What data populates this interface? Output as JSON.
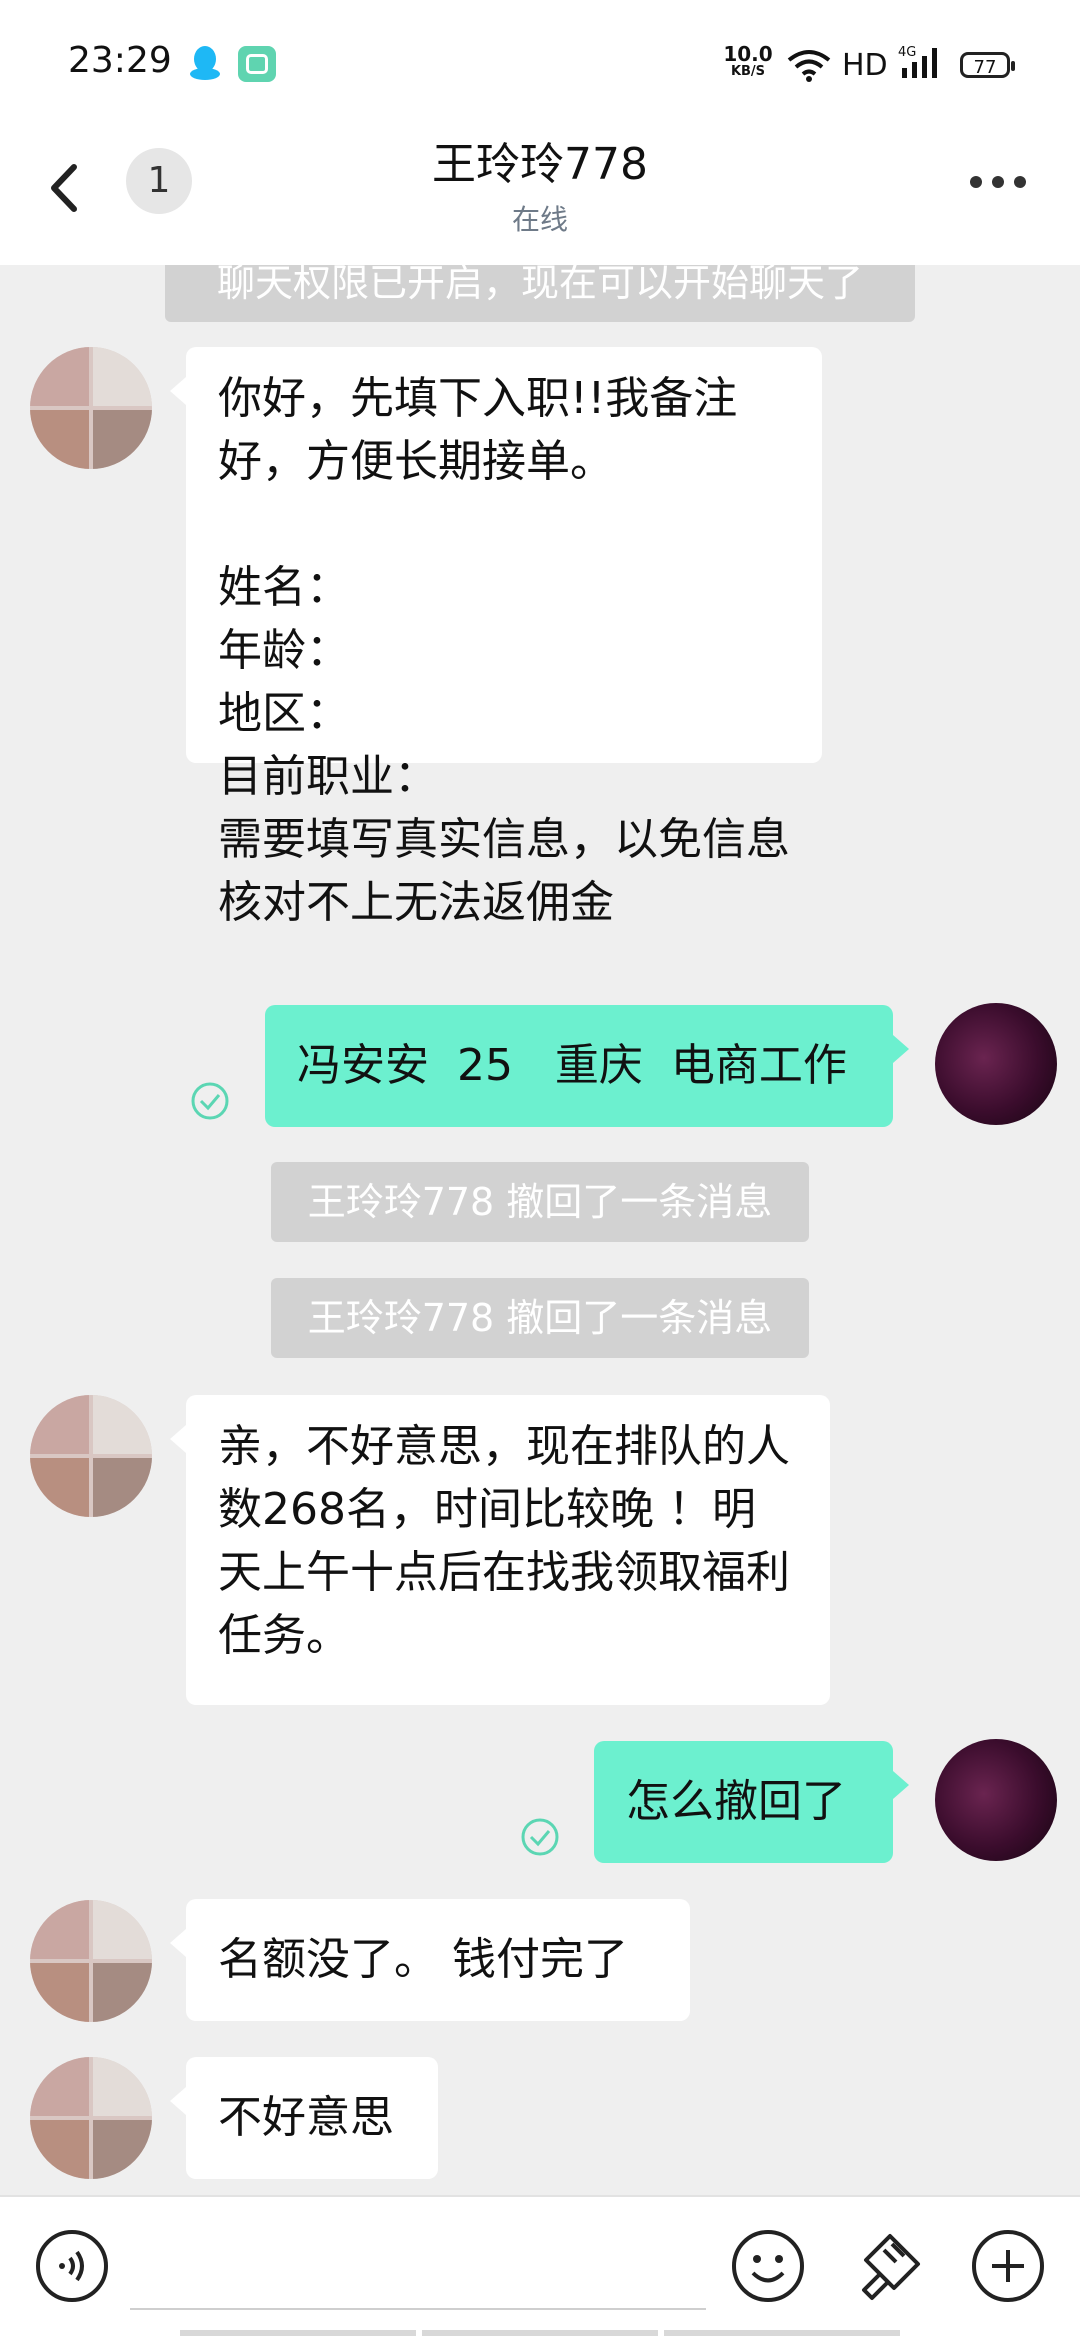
{
  "status_bar": {
    "time": "23:29",
    "net_speed_value": "10.0",
    "net_speed_unit": "KB/S",
    "hd": "HD",
    "network": "4G",
    "battery": "77",
    "icons": [
      "qq-icon",
      "app-icon",
      "wifi-icon",
      "signal-icon",
      "battery-icon"
    ]
  },
  "header": {
    "unread_count": "1",
    "title": "王玲玲778",
    "status": "在线",
    "icons": [
      "back-icon",
      "more-icon"
    ]
  },
  "messages": {
    "system_top": "聊天权限已开启，现在可以开始聊天了",
    "m1": "你好，先填下入职!!我备注好，方便长期接单。\n\n姓名：\n年龄：\n地区：\n目前职业：\n需要填写真实信息，以免信息核对不上无法返佣金",
    "m2": "冯安安  25   重庆  电商工作",
    "recall_1": "王玲玲778 撤回了一条消息",
    "recall_2": "王玲玲778 撤回了一条消息",
    "m3": "亲，不好意思，现在排队的人数268名，时间比较晚 ！明天上午十点后在找我领取福利任务。",
    "m4": "怎么撤回了",
    "m5": "名额没了。 钱付完了",
    "m6": "不好意思"
  },
  "bottom_bar": {
    "icons": [
      "voice-icon",
      "emoji-icon",
      "brush-icon",
      "add-icon"
    ]
  },
  "colors": {
    "outgoing_bubble": "#6cf0cf",
    "incoming_bubble": "#ffffff",
    "chat_background": "#efefef",
    "system_message": "#d2d2d2"
  }
}
